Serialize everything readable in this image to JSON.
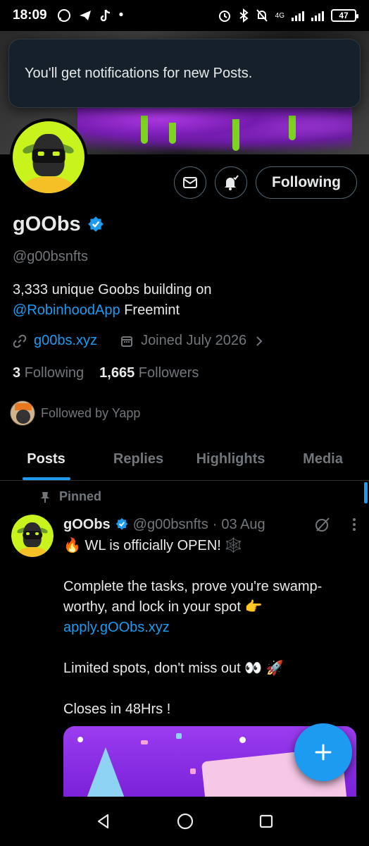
{
  "status_bar": {
    "time": "18:09",
    "network": "4G",
    "battery": "47"
  },
  "toast": {
    "message": "You'll get notifications for new Posts."
  },
  "profile": {
    "display_name": "gOObs",
    "handle": "@g00bsnfts",
    "bio_line1": "3,333 unique Goobs building on",
    "bio_mention": "@RobinhoodApp",
    "bio_rest": " Freemint",
    "website": "g00bs.xyz",
    "joined": "Joined July 2026",
    "following_count": "3",
    "following_label": "Following",
    "followers_count": "1,665",
    "followers_label": "Followers",
    "followed_by": "Followed by Yapp"
  },
  "actions": {
    "following_button": "Following"
  },
  "tabs": [
    {
      "label": "Posts",
      "active": true
    },
    {
      "label": "Replies",
      "active": false
    },
    {
      "label": "Highlights",
      "active": false
    },
    {
      "label": "Media",
      "active": false
    }
  ],
  "pinned_post": {
    "pinned_label": "Pinned",
    "author_name": "gOObs",
    "author_handle": "@g00bsnfts",
    "dot": "·",
    "date": "03 Aug",
    "line1": "🔥 WL is officially OPEN! 🕸️",
    "line2": "Complete the tasks, prove you're swamp-worthy, and lock in your spot 👉",
    "link": "apply.gOObs.xyz",
    "line3": "Limited spots, don't miss out 👀 🚀",
    "line4": "Closes in 48Hrs !"
  },
  "colors": {
    "accent": "#1d9bf0",
    "background": "#000000",
    "text_primary": "#e7e9ea",
    "text_secondary": "#71767b",
    "avatar_bg": "#c8f31c"
  },
  "icons": {
    "mail": "mail-icon",
    "bell": "bell-icon",
    "link": "link-icon",
    "calendar": "calendar-icon",
    "pin": "pin-icon",
    "grok": "grok-icon",
    "more": "more-icon",
    "compose": "plus-icon"
  }
}
